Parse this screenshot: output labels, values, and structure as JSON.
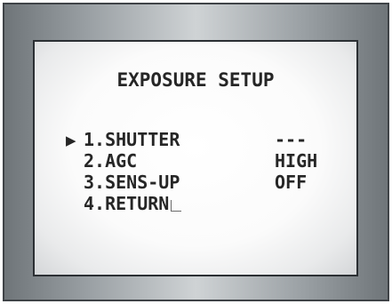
{
  "menu": {
    "title": "EXPOSURE SETUP",
    "cursor": "▶",
    "items": [
      {
        "label": "1.SHUTTER",
        "value": "---"
      },
      {
        "label": "2.AGC",
        "value": "HIGH"
      },
      {
        "label": "3.SENS-UP",
        "value": "OFF"
      },
      {
        "label": "4.RETURN",
        "value": ""
      }
    ],
    "enter_icon": "enter-return-icon",
    "selected_index": 0
  },
  "colors": {
    "text": "#262626",
    "screen_bg": "#ffffff",
    "frame": "#8a9094"
  }
}
